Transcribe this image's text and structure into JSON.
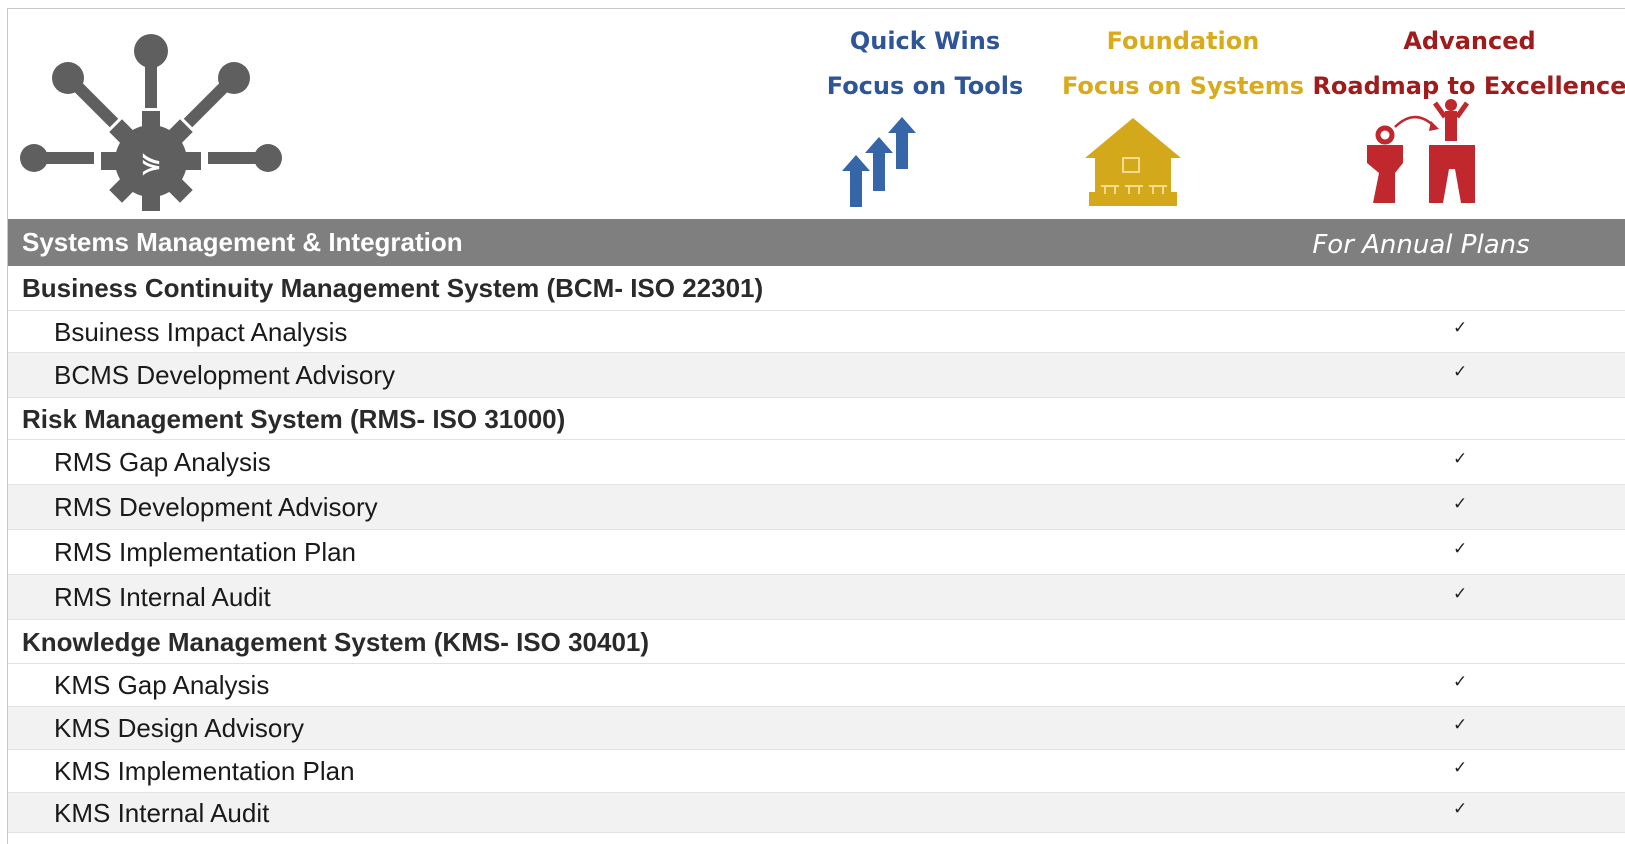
{
  "header": {
    "columns": [
      {
        "line1": "Quick Wins",
        "line2": "Focus on Tools",
        "icon": "stairs-arrows-icon",
        "color": "#2e5597"
      },
      {
        "line1": "Foundation",
        "line2": "Focus on Systems",
        "icon": "house-foundation-icon",
        "color": "#d9ab1c"
      },
      {
        "line1": "Advanced",
        "line2": "Roadmap to Excellence",
        "icon": "leap-gap-icon",
        "color": "#a01c1c"
      }
    ],
    "logo_icon": "gear-network-icon"
  },
  "band": {
    "title": "Systems Management & Integration",
    "note": "For Annual Plans"
  },
  "rows": [
    {
      "type": "section",
      "label": "Business Continuity Management System (BCM- ISO 22301)",
      "check": ""
    },
    {
      "type": "item",
      "label": "Bsuiness Impact Analysis",
      "check": "✓"
    },
    {
      "type": "item",
      "label": "BCMS Development Advisory",
      "check": "✓"
    },
    {
      "type": "section",
      "label": "Risk Management System (RMS- ISO 31000)",
      "check": ""
    },
    {
      "type": "item",
      "label": "RMS Gap Analysis",
      "check": "✓"
    },
    {
      "type": "item",
      "label": "RMS Development Advisory",
      "check": "✓"
    },
    {
      "type": "item",
      "label": "RMS Implementation Plan",
      "check": "✓"
    },
    {
      "type": "item",
      "label": "RMS Internal Audit",
      "check": "✓"
    },
    {
      "type": "section",
      "label": "Knowledge Management System (KMS- ISO 30401)",
      "check": ""
    },
    {
      "type": "item",
      "label": "KMS Gap Analysis",
      "check": "✓"
    },
    {
      "type": "item",
      "label": "KMS Design Advisory",
      "check": "✓"
    },
    {
      "type": "item",
      "label": "KMS Implementation Plan",
      "check": "✓"
    },
    {
      "type": "item",
      "label": "KMS Internal Audit",
      "check": "✓"
    }
  ]
}
